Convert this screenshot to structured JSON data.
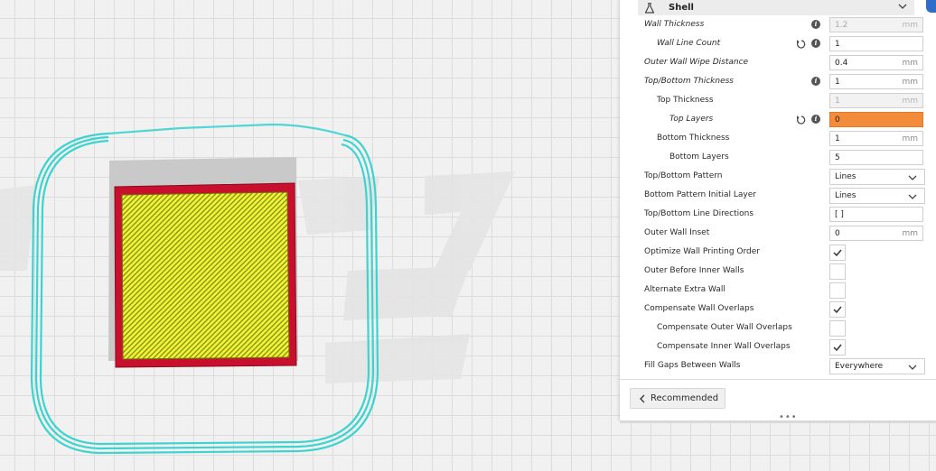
{
  "section": {
    "title": "Shell",
    "icon": "flask-icon"
  },
  "settings": [
    {
      "key": "wall-thickness",
      "label": "Wall Thickness",
      "indent": 0,
      "italic": true,
      "reset": false,
      "info": true,
      "control": "number",
      "value": "1.2",
      "unit": "mm",
      "state": "disabled"
    },
    {
      "key": "wall-line-count",
      "label": "Wall Line Count",
      "indent": 1,
      "italic": true,
      "reset": true,
      "info": true,
      "control": "number",
      "value": "1",
      "unit": "",
      "state": "normal"
    },
    {
      "key": "outer-wall-wipe-distance",
      "label": "Outer Wall Wipe Distance",
      "indent": 0,
      "italic": true,
      "reset": false,
      "info": false,
      "control": "number",
      "value": "0.4",
      "unit": "mm",
      "state": "normal"
    },
    {
      "key": "top-bottom-thickness",
      "label": "Top/Bottom Thickness",
      "indent": 0,
      "italic": true,
      "reset": false,
      "info": true,
      "control": "number",
      "value": "1",
      "unit": "mm",
      "state": "normal"
    },
    {
      "key": "top-thickness",
      "label": "Top Thickness",
      "indent": 1,
      "italic": false,
      "reset": false,
      "info": false,
      "control": "number",
      "value": "1",
      "unit": "mm",
      "state": "disabled"
    },
    {
      "key": "top-layers",
      "label": "Top Layers",
      "indent": 2,
      "italic": true,
      "reset": true,
      "info": true,
      "control": "number",
      "value": "0",
      "unit": "",
      "state": "error"
    },
    {
      "key": "bottom-thickness",
      "label": "Bottom Thickness",
      "indent": 1,
      "italic": false,
      "reset": false,
      "info": false,
      "control": "number",
      "value": "1",
      "unit": "mm",
      "state": "normal"
    },
    {
      "key": "bottom-layers",
      "label": "Bottom Layers",
      "indent": 2,
      "italic": false,
      "reset": false,
      "info": false,
      "control": "number",
      "value": "5",
      "unit": "",
      "state": "normal"
    },
    {
      "key": "top-bottom-pattern",
      "label": "Top/Bottom Pattern",
      "indent": 0,
      "italic": false,
      "reset": false,
      "info": false,
      "control": "select",
      "value": "Lines"
    },
    {
      "key": "bottom-pattern-initial-layer",
      "label": "Bottom Pattern Initial Layer",
      "indent": 0,
      "italic": false,
      "reset": false,
      "info": false,
      "control": "select",
      "value": "Lines"
    },
    {
      "key": "top-bottom-line-directions",
      "label": "Top/Bottom Line Directions",
      "indent": 0,
      "italic": false,
      "reset": false,
      "info": false,
      "control": "number",
      "value": "[ ]",
      "unit": "",
      "state": "normal"
    },
    {
      "key": "outer-wall-inset",
      "label": "Outer Wall Inset",
      "indent": 0,
      "italic": false,
      "reset": false,
      "info": false,
      "control": "number",
      "value": "0",
      "unit": "mm",
      "state": "normal"
    },
    {
      "key": "optimize-wall-printing-order",
      "label": "Optimize Wall Printing Order",
      "indent": 0,
      "italic": false,
      "reset": false,
      "info": false,
      "control": "checkbox",
      "checked": true
    },
    {
      "key": "outer-before-inner-walls",
      "label": "Outer Before Inner Walls",
      "indent": 0,
      "italic": false,
      "reset": false,
      "info": false,
      "control": "checkbox",
      "checked": false
    },
    {
      "key": "alternate-extra-wall",
      "label": "Alternate Extra Wall",
      "indent": 0,
      "italic": false,
      "reset": false,
      "info": false,
      "control": "checkbox",
      "checked": false
    },
    {
      "key": "compensate-wall-overlaps",
      "label": "Compensate Wall Overlaps",
      "indent": 0,
      "italic": false,
      "reset": false,
      "info": false,
      "control": "checkbox",
      "checked": true
    },
    {
      "key": "compensate-outer-wall-overlaps",
      "label": "Compensate Outer Wall Overlaps",
      "indent": 1,
      "italic": false,
      "reset": false,
      "info": false,
      "control": "checkbox",
      "checked": false
    },
    {
      "key": "compensate-inner-wall-overlaps",
      "label": "Compensate Inner Wall Overlaps",
      "indent": 1,
      "italic": false,
      "reset": false,
      "info": false,
      "control": "checkbox",
      "checked": true
    },
    {
      "key": "fill-gaps-between-walls",
      "label": "Fill Gaps Between Walls",
      "indent": 0,
      "italic": false,
      "reset": false,
      "info": false,
      "control": "select",
      "value": "Everywhere"
    }
  ],
  "footer": {
    "recommended_label": "Recommended",
    "handle": "•••"
  },
  "colors": {
    "skirt": "#3fd3cf",
    "wall": "#c8102e",
    "top_skin": "#e8ef2a",
    "error_field": "#f28c3a",
    "accent": "#2e6ec8"
  }
}
